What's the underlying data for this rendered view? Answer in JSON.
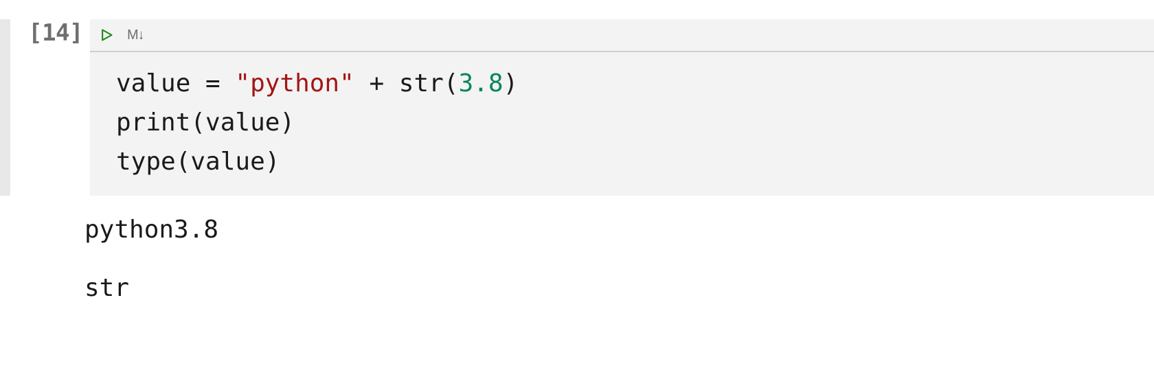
{
  "cell": {
    "prompt": "[14]",
    "toolbar": {
      "run": "run",
      "markdown": "M↓"
    },
    "code": {
      "line1_a": "value = ",
      "line1_str": "\"python\"",
      "line1_b": " + str(",
      "line1_num": "3.8",
      "line1_c": ")",
      "line2": "print(value)",
      "line3": "type(value)"
    },
    "output": {
      "stdout": "python3.8",
      "result": "str"
    }
  }
}
